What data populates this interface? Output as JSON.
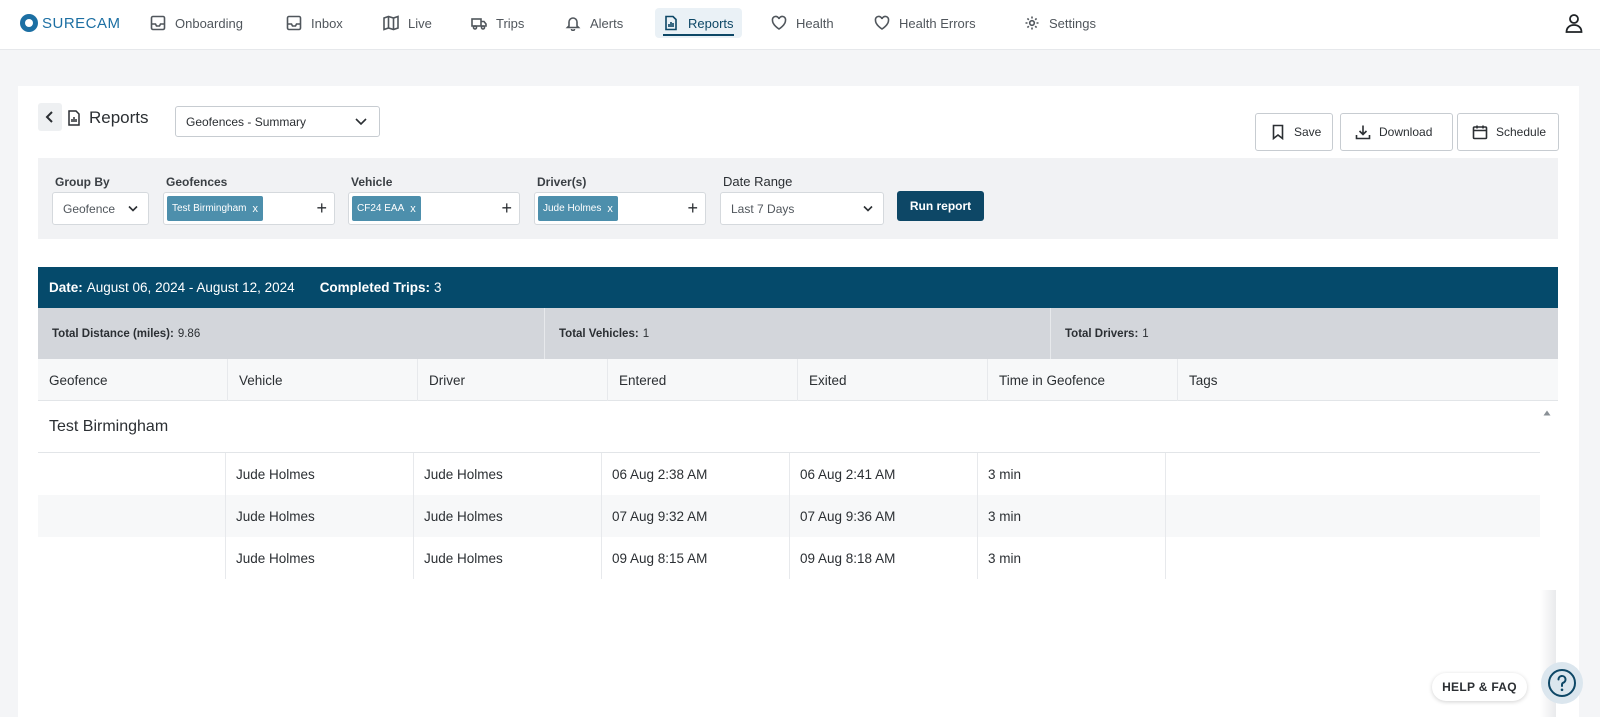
{
  "app": {
    "logo_text": "SURECAM"
  },
  "nav": {
    "items": [
      {
        "label": "Onboarding",
        "icon": "inbox-icon"
      },
      {
        "label": "Inbox",
        "icon": "inbox-icon"
      },
      {
        "label": "Live",
        "icon": "map-icon"
      },
      {
        "label": "Trips",
        "icon": "truck-icon"
      },
      {
        "label": "Alerts",
        "icon": "bell-icon"
      },
      {
        "label": "Reports",
        "icon": "report-icon",
        "active": true
      },
      {
        "label": "Health",
        "icon": "heart-icon"
      },
      {
        "label": "Health Errors",
        "icon": "heart-icon"
      },
      {
        "label": "Settings",
        "icon": "gear-icon"
      }
    ]
  },
  "page": {
    "title": "Reports",
    "report_type": "Geofences - Summary",
    "actions": {
      "save": "Save",
      "download": "Download",
      "schedule": "Schedule"
    }
  },
  "filters": {
    "group_by": {
      "label": "Group By",
      "value": "Geofence"
    },
    "geofences": {
      "label": "Geofences",
      "chip": "Test Birmingham",
      "remove": "x",
      "add": "+"
    },
    "vehicle": {
      "label": "Vehicle",
      "chip": "CF24 EAA",
      "remove": "x",
      "add": "+"
    },
    "drivers": {
      "label": "Driver(s)",
      "chip": "Jude Holmes",
      "remove": "x",
      "add": "+"
    },
    "date_range": {
      "label": "Date Range",
      "value": "Last 7 Days"
    },
    "run_label": "Run report"
  },
  "summary": {
    "date_key": "Date:",
    "date_value": "August 06, 2024 - August 12, 2024",
    "trips_key": "Completed Trips:",
    "trips_value": "3",
    "distance_key": "Total Distance (miles):",
    "distance_value": "9.86",
    "vehicles_key": "Total Vehicles:",
    "vehicles_value": "1",
    "drivers_key": "Total Drivers:",
    "drivers_value": "1"
  },
  "table": {
    "columns": [
      "Geofence",
      "Vehicle",
      "Driver",
      "Entered",
      "Exited",
      "Time in Geofence",
      "Tags"
    ],
    "group_name": "Test Birmingham",
    "rows": [
      {
        "geofence": "",
        "vehicle": "Jude Holmes",
        "driver": "Jude Holmes",
        "entered": "06 Aug 2:38 AM",
        "exited": "06 Aug 2:41 AM",
        "time": "3 min",
        "tags": ""
      },
      {
        "geofence": "",
        "vehicle": "Jude Holmes",
        "driver": "Jude Holmes",
        "entered": "07 Aug 9:32 AM",
        "exited": "07 Aug 9:36 AM",
        "time": "3 min",
        "tags": ""
      },
      {
        "geofence": "",
        "vehicle": "Jude Holmes",
        "driver": "Jude Holmes",
        "entered": "09 Aug 8:15 AM",
        "exited": "09 Aug 8:18 AM",
        "time": "3 min",
        "tags": ""
      }
    ]
  },
  "help": {
    "label": "HELP & FAQ"
  },
  "colors": {
    "primary": "#054a6b",
    "chip": "#4d8fac",
    "brand": "#1c6fa3"
  }
}
